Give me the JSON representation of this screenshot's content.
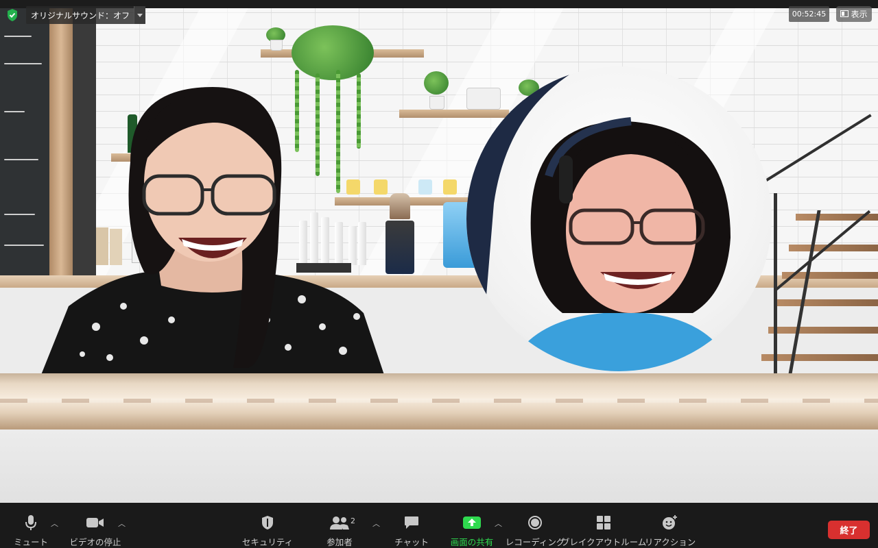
{
  "top_left": {
    "audio_label": "オリジナルサウンド：オフ"
  },
  "top_right": {
    "timer": "00:52:45",
    "view_label": "表示"
  },
  "toolbar": {
    "mute": "ミュート",
    "stop_video": "ビデオの停止",
    "security": "セキュリティ",
    "participants": "参加者",
    "participants_count": "2",
    "chat": "チャット",
    "share_screen": "画面の共有",
    "recording": "レコーディング",
    "breakout": "ブレイクアウトルーム",
    "reactions": "リアクション",
    "end": "終了"
  },
  "colors": {
    "share_green": "#2fd94f",
    "end_red": "#d8302f",
    "toolbar_bg": "#1a1a1a"
  },
  "icons": [
    "shield-check-icon",
    "chevron-down-icon",
    "microphone-icon",
    "video-camera-icon",
    "shield-icon",
    "people-icon",
    "chat-bubble-icon",
    "share-screen-icon",
    "record-icon",
    "grid-icon",
    "smiley-add-icon",
    "caret-up-icon",
    "view-icon"
  ]
}
